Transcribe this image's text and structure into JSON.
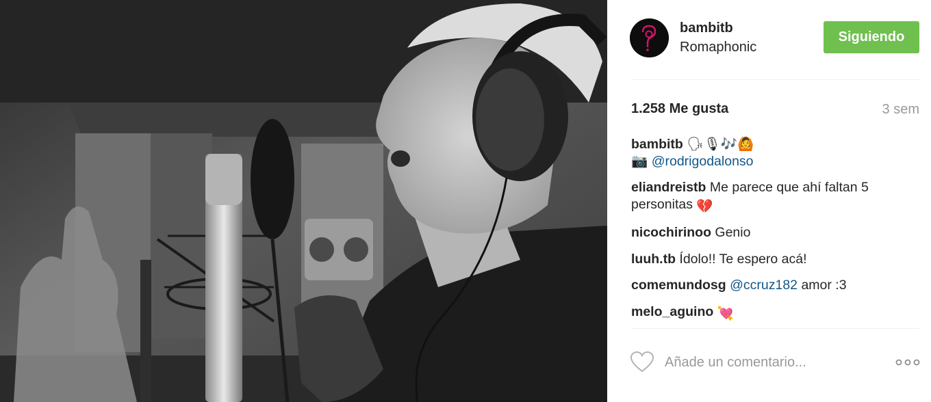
{
  "post": {
    "photo": {
      "alt": "recording-studio-singer-photo"
    },
    "header": {
      "username": "bambitb",
      "location": "Romaphonic",
      "follow_label": "Siguiendo"
    },
    "stats": {
      "likes": "1.258 Me gusta",
      "time": "3 sem"
    },
    "caption": {
      "user": "bambitb",
      "emojis": "🗣🎙🎶🙆",
      "camera_emoji": "📷",
      "mention": "@rodrigodalonso"
    },
    "comments": [
      {
        "user": "eliandreistb",
        "text": "Me parece que ahí faltan 5 personitas",
        "emoji": "💔"
      },
      {
        "user": "nicochirinoo",
        "text": "Genio",
        "emoji": ""
      },
      {
        "user": "luuh.tb",
        "text": "Ídolo!! Te espero acá!",
        "emoji": ""
      },
      {
        "user": "comemundosg",
        "mention": "@ccruz182",
        "text": "amor :3",
        "emoji": ""
      },
      {
        "user": "melo_aguino",
        "text": "",
        "emoji": "💘"
      }
    ],
    "footer": {
      "comment_placeholder": "Añade un comentario...",
      "like_icon": "heart-outline-icon",
      "more_icon": "more-options-icon"
    },
    "colors": {
      "follow_button": "#70c050",
      "mention": "#125688",
      "muted": "#999999"
    }
  }
}
